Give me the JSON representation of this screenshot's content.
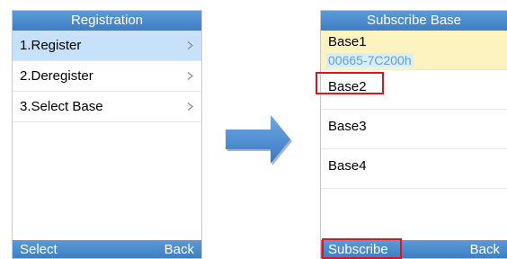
{
  "left_screen": {
    "title": "Registration",
    "menu": [
      {
        "label": "1.Register",
        "selected": true
      },
      {
        "label": "2.Deregister",
        "selected": false
      },
      {
        "label": "3.Select Base",
        "selected": false
      }
    ],
    "softkeys": {
      "left": "Select",
      "right": "Back"
    }
  },
  "right_screen": {
    "title": "Subscribe Base",
    "bases": [
      {
        "label": "Base1",
        "id": "00665-7C200h"
      },
      {
        "label": "Base2"
      },
      {
        "label": "Base3"
      },
      {
        "label": "Base4"
      }
    ],
    "softkeys": {
      "left": "Subscribe",
      "right": "Back"
    }
  },
  "colors": {
    "title_bar": "#4a8bcc",
    "selected_row": "#c8e1fa",
    "highlight_row": "#fdf3c0",
    "callout_box": "#e0141e",
    "arrow": "#4b8fd6"
  },
  "icons": {
    "menu_chevron": "chevron-right-icon",
    "transition": "arrow-right-icon"
  }
}
